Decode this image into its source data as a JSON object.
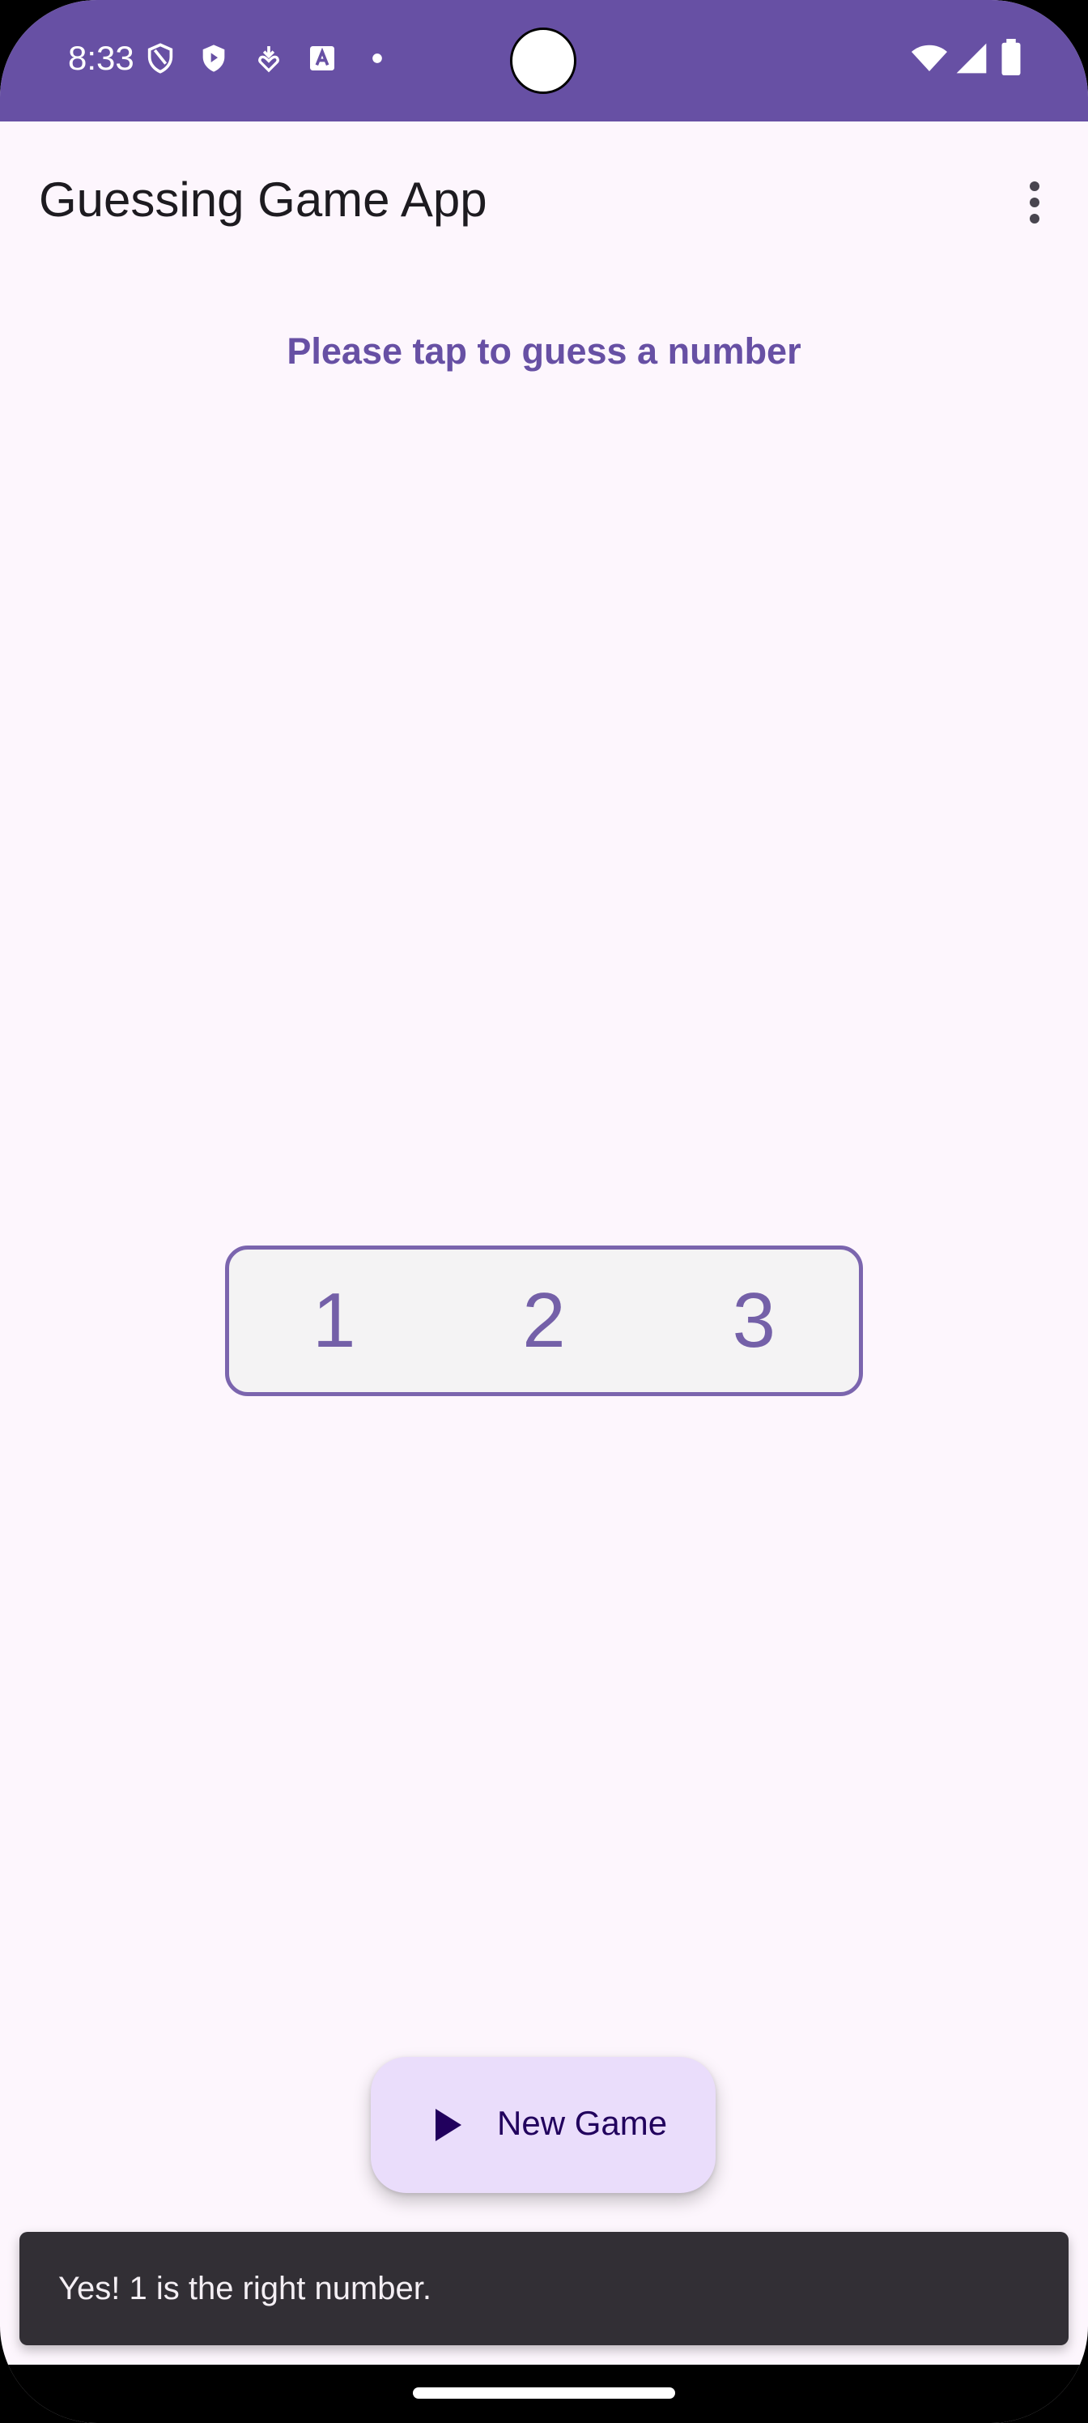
{
  "status_bar": {
    "time": "8:33",
    "left_icons": [
      "shield-outline-icon",
      "shield-filled-icon",
      "heart-download-icon",
      "font-a-icon",
      "dot-icon"
    ],
    "right_icons": [
      "wifi-icon",
      "cell-signal-icon",
      "battery-icon"
    ],
    "background_color": "#6750A4"
  },
  "app_bar": {
    "title": "Guessing Game App",
    "menu_icon": "more-vert-icon"
  },
  "main": {
    "prompt": "Please tap to guess a number",
    "numbers": [
      "1",
      "2",
      "3"
    ]
  },
  "fab": {
    "icon": "play-icon",
    "label": "New Game",
    "background_color": "#EADDFB"
  },
  "snackbar": {
    "message": "Yes! 1 is the right number."
  },
  "colors": {
    "primary": "#6750A4",
    "surface": "#FDF6FD",
    "on_surface": "#1D1B20",
    "snackbar_bg": "#322F35"
  }
}
